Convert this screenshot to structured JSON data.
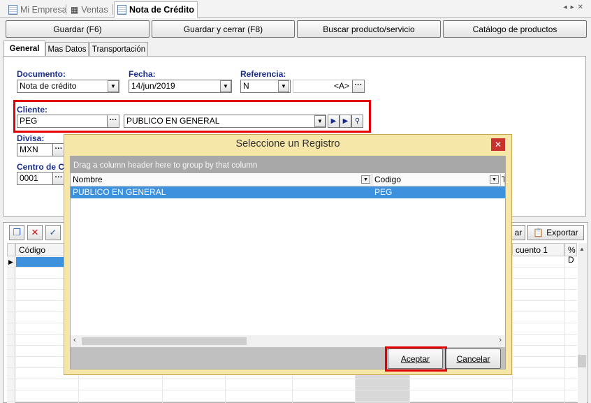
{
  "doc_tabs": [
    {
      "label": "Mi Empresa"
    },
    {
      "label": "Ventas"
    },
    {
      "label": "Nota de Crédito"
    }
  ],
  "toolbar": {
    "save": "Guardar (F6)",
    "save_close": "Guardar y cerrar (F8)",
    "search_product": "Buscar producto/servicio",
    "catalog": "Catálogo de productos"
  },
  "form_tabs": [
    "General",
    "Mas Datos",
    "Transportación"
  ],
  "form": {
    "documento_label": "Documento:",
    "documento_value": "Nota de crédito",
    "fecha_label": "Fecha:",
    "fecha_value": "14/jun/2019",
    "referencia_label": "Referencia:",
    "referencia_value": "N",
    "referencia_extra": "<A>",
    "cliente_label": "Cliente:",
    "cliente_code": "PEG",
    "cliente_name": "PUBLICO EN GENERAL",
    "divisa_label": "Divisa:",
    "divisa_value": "MXN",
    "centro_label": "Centro de C",
    "centro_value": "0001"
  },
  "grid": {
    "export_partial": "ar",
    "export_label": "Exportar",
    "col_codigo": "Código",
    "col_descuento": "cuento 1",
    "col_pct": "% D"
  },
  "dialog": {
    "title": "Seleccione un Registro",
    "group_hint": "Drag a column header here to group by that column",
    "columns": [
      "Nombre",
      "Codigo",
      "T"
    ],
    "rows": [
      {
        "nombre": "PUBLICO EN GENERAL",
        "codigo": "PEG"
      }
    ],
    "accept": "Aceptar",
    "cancel": "Cancelar"
  },
  "colors": {
    "label_blue": "#1a2c8c",
    "highlight_red": "#e30000",
    "selection_blue": "#3e91dc",
    "dialog_frame": "#f6e6a8"
  }
}
